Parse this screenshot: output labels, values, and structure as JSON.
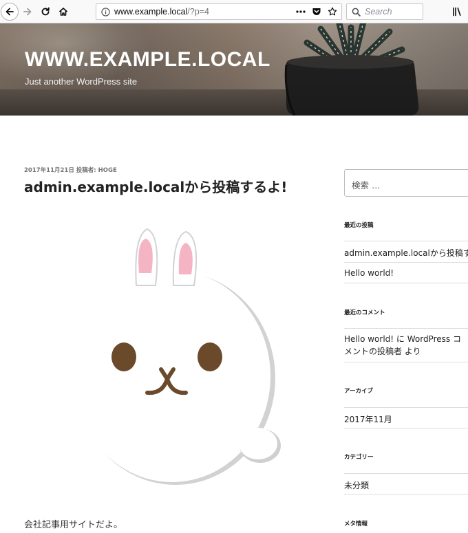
{
  "browser": {
    "url_host": "www.example.local",
    "url_path": "/?p=4",
    "search_placeholder": "Search"
  },
  "site": {
    "title": "WWW.EXAMPLE.LOCAL",
    "description": "Just another WordPress site"
  },
  "post": {
    "meta": "2017年11月21日 投稿者: HOGE",
    "title": "admin.example.localから投稿するよ!",
    "body": "会社記事用サイトだよ。"
  },
  "sidebar": {
    "search_placeholder": "検索 …",
    "recent_posts": {
      "title": "最近の投稿",
      "items": [
        "admin.example.localから投稿するよ!",
        "Hello world!"
      ]
    },
    "recent_comments": {
      "title": "最近のコメント",
      "items": [
        "Hello world! に WordPress コメントの投稿者 より"
      ]
    },
    "archives": {
      "title": "アーカイブ",
      "items": [
        "2017年11月"
      ]
    },
    "categories": {
      "title": "カテゴリー",
      "items": [
        "未分類"
      ]
    },
    "meta": {
      "title": "メタ情報"
    }
  },
  "colors": {
    "accent_rabbit_ears": "#f4b4c4",
    "rabbit_features": "#6b4a2b"
  }
}
